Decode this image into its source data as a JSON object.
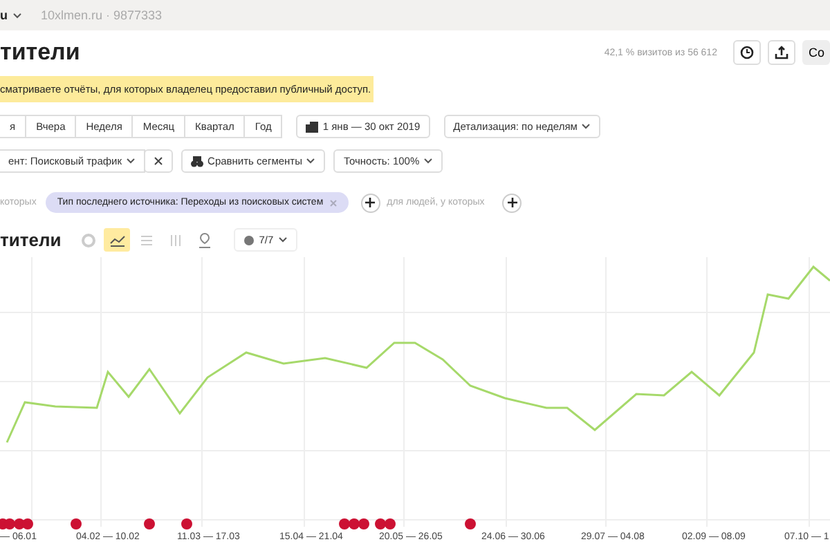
{
  "top_bar": {
    "site_cut": "u",
    "counter": "10xlmen.ru · 9877333"
  },
  "header": {
    "title": "тители",
    "visits": "42,1 % визитов из 56 612",
    "button_cut": "Со"
  },
  "notice": "сматриваете отчёты, для которых владелец предоставил публичный доступ.",
  "periods": [
    {
      "label": "я",
      "selected": false
    },
    {
      "label": "Вчера",
      "selected": false
    },
    {
      "label": "Неделя",
      "selected": false
    },
    {
      "label": "Месяц",
      "selected": false
    },
    {
      "label": "Квартал",
      "selected": false
    },
    {
      "label": "Год",
      "selected": false
    }
  ],
  "date_range": "1 янв — 30 окт 2019",
  "detail": "Детализация: по неделям",
  "segment": "ент: Поисковый трафик",
  "compare": "Сравнить сегменты",
  "accuracy": "Точность: 100%",
  "filters": {
    "prefix": "которых",
    "pill": "Тип последнего источника: Переходы из поисковых систем",
    "people": "для людей, у которых"
  },
  "chart_header": {
    "title": "тители",
    "views": [
      {
        "kind": "pie",
        "selected": false
      },
      {
        "kind": "line",
        "selected": true
      },
      {
        "kind": "list",
        "selected": false
      },
      {
        "kind": "bars",
        "selected": false
      },
      {
        "kind": "map",
        "selected": false
      }
    ],
    "series_count": "7/7"
  },
  "x_labels": [
    "— 06.01",
    "04.02 — 10.02",
    "11.03 — 17.03",
    "15.04 — 21.04",
    "20.05 — 26.05",
    "24.06 — 30.06",
    "29.07 — 04.08",
    "02.09 — 08.09",
    "07.10 — 1"
  ]
}
